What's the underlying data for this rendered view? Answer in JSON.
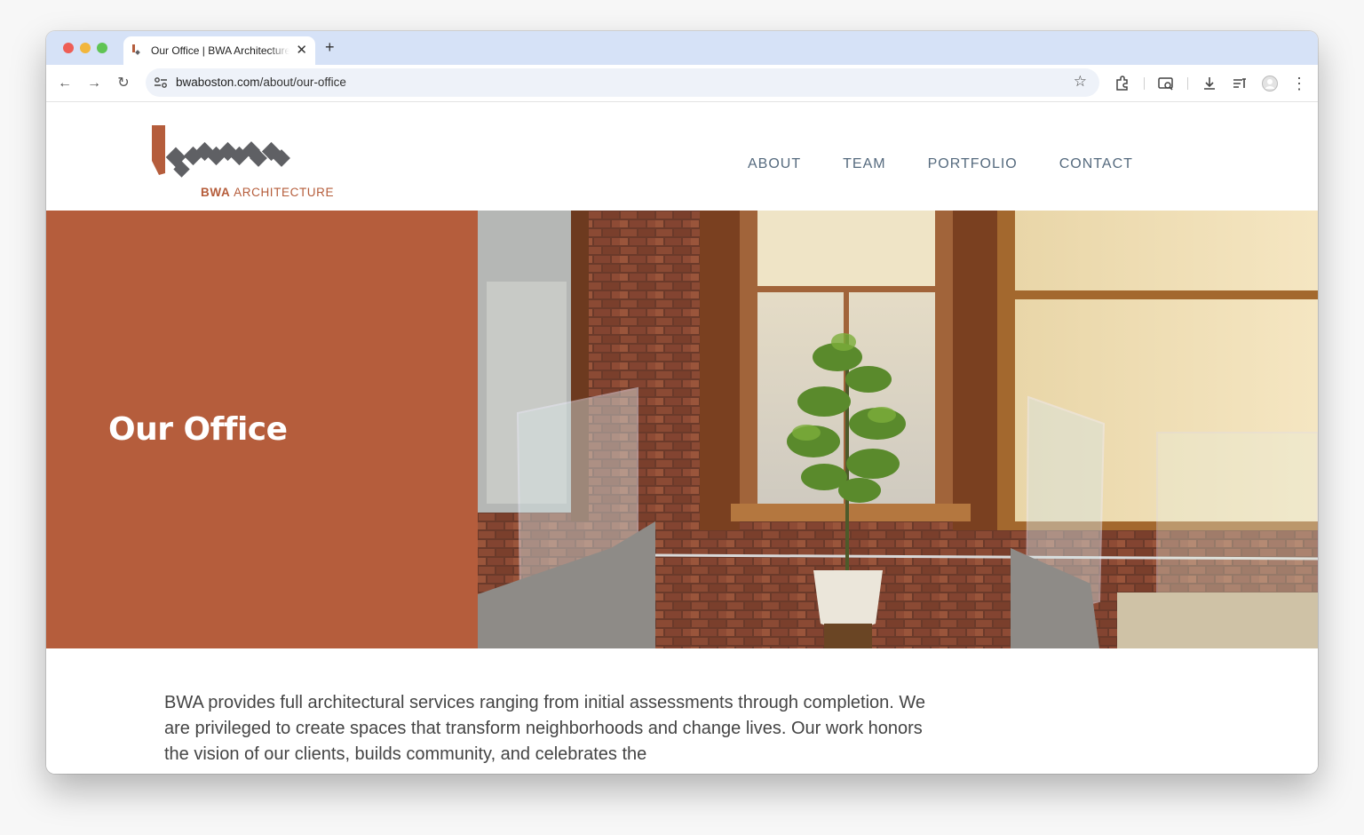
{
  "browser": {
    "tab": {
      "title": "Our Office | BWA Architecture",
      "close_glyph": "✕"
    },
    "new_tab_glyph": "+",
    "toolbar": {
      "back_glyph": "←",
      "forward_glyph": "→",
      "reload_glyph": "↻",
      "url_domain": "bwaboston.com",
      "url_path": "/about/our-office",
      "bookmark_glyph": "☆",
      "menu_glyph": "⋮"
    },
    "icons": [
      "site-info-icon",
      "bookmark-star-icon",
      "extensions-icon",
      "tab-search-icon",
      "download-icon",
      "reading-list-icon",
      "profile-avatar-icon",
      "menu-icon"
    ]
  },
  "site": {
    "logo_text_bold": "BWA",
    "logo_text_light": "ARCHITECTURE",
    "nav": [
      "ABOUT",
      "TEAM",
      "PORTFOLIO",
      "CONTACT"
    ],
    "hero_title": "Our Office",
    "intro": "BWA provides full architectural services ranging from initial assessments through completion. We are privileged to create spaces that transform neighborhoods and change lives. Our work honors the vision of our clients, builds community, and celebrates the",
    "colors": {
      "accent": "#b55d3c",
      "nav_text": "#556a7e",
      "logo_gray": "#5f6064"
    }
  }
}
